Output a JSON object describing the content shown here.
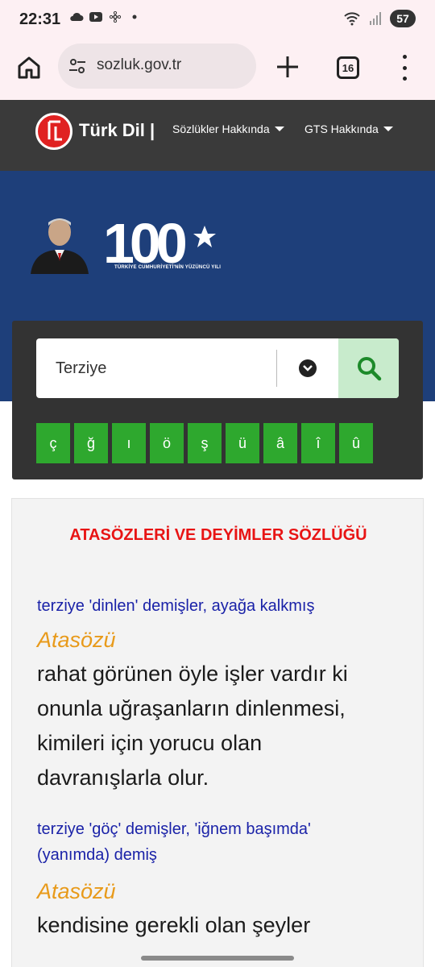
{
  "status_bar": {
    "time": "22:31",
    "battery": "57",
    "icons": [
      "cloud-icon",
      "youtube-icon",
      "fan-icon",
      "dot-icon",
      "wifi-icon",
      "signal-icon",
      "battery-icon"
    ]
  },
  "browser": {
    "url": "sozluk.gov.tr",
    "tab_count": "16"
  },
  "site_nav": {
    "logo_text": "Türk Dil |",
    "links": [
      {
        "label": "Sözlükler Hakkında"
      },
      {
        "label": "GTS Hakkında"
      }
    ]
  },
  "hero": {
    "number": "100",
    "subtitle": "TÜRKİYE CUMHURİYETİ'NİN YÜZÜNCÜ YILI"
  },
  "search": {
    "value": "Terziye",
    "letters": [
      "ç",
      "ğ",
      "ı",
      "ö",
      "ş",
      "ü",
      "â",
      "î",
      "û"
    ]
  },
  "results": {
    "title": "ATASÖZLERİ VE DEYİMLER SÖZLÜĞÜ",
    "entries": [
      {
        "head_lines": [
          "terziye 'dinlen' demişler, ayağa kalkmış"
        ],
        "type": "Atasözü",
        "definition_lines": [
          "rahat görünen öyle işler vardır ki",
          "onunla uğraşanların dinlenmesi,",
          "kimileri için yorucu olan",
          "davranışlarla olur."
        ]
      },
      {
        "head_lines": [
          "terziye 'göç' demişler, 'iğnem başımda'",
          "(yanımda) demiş"
        ],
        "type": "Atasözü",
        "definition_lines": [
          "kendisine gerekli olan şeyler"
        ]
      }
    ]
  },
  "colors": {
    "status_bg": "#fdf0f3",
    "nav_bg": "#3a3a3a",
    "hero_bg": "#1e3f7a",
    "letter_btn": "#2ea82e",
    "search_btn": "#c8ebcc",
    "title_red": "#e81414",
    "link_blue": "#1a22a8",
    "type_orange": "#e89a1a"
  }
}
